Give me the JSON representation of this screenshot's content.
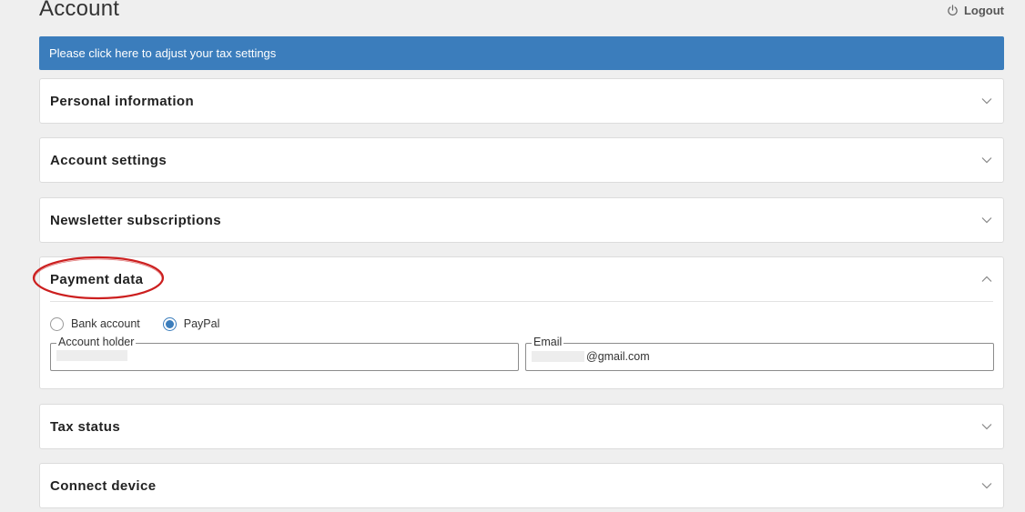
{
  "header": {
    "title": "Account",
    "logout_label": "Logout"
  },
  "banner": {
    "text": "Please click here to adjust your tax settings",
    "color": "#3b7dbc"
  },
  "sections": {
    "personal": {
      "title": "Personal information",
      "expanded": false
    },
    "account_settings": {
      "title": "Account settings",
      "expanded": false
    },
    "newsletter": {
      "title": "Newsletter subscriptions",
      "expanded": false
    },
    "payment": {
      "title": "Payment data",
      "expanded": true,
      "highlight_color": "#cc1f1f",
      "methods": [
        {
          "label": "Bank account",
          "selected": false
        },
        {
          "label": "PayPal",
          "selected": true
        }
      ],
      "account_holder": {
        "label": "Account holder",
        "value": ""
      },
      "email": {
        "label": "Email",
        "value_suffix": "@gmail.com"
      }
    },
    "tax_status": {
      "title": "Tax status",
      "expanded": false
    },
    "connect_device": {
      "title": "Connect device",
      "expanded": false
    }
  },
  "icons": {
    "logout": "power-icon",
    "collapsed": "chevron-down-icon",
    "expanded": "chevron-up-icon"
  }
}
